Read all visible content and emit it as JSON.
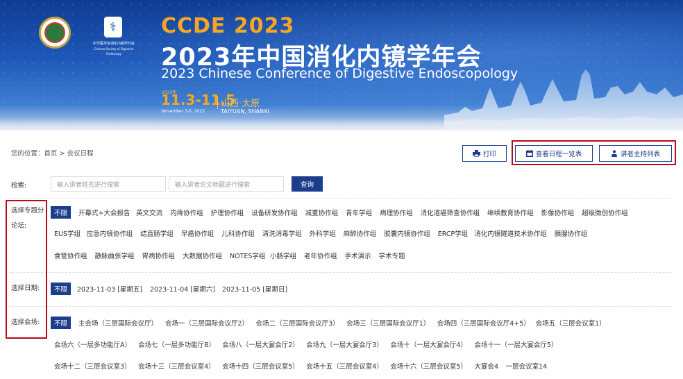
{
  "banner": {
    "ccde": "CCDE 2023",
    "title_cn": "2023年中国消化内镜学年会",
    "title_en": "2023 Chinese Conference of Digestive Endoscopology",
    "date_year": "2023年",
    "date_big": "11.3-11.5",
    "date_small": "November 3-5, 2023",
    "location_cn": "山西·太原",
    "location_en": "TAIYUAN, SHANXI",
    "logo2_text_cn": "中华医学会消化内镜学分会",
    "logo2_text_en": "Chinese Society of Digestive Endoscopy"
  },
  "breadcrumb": {
    "prefix": "您的位置：",
    "home": "首页",
    "sep": ">",
    "current": "会议日程"
  },
  "toolbar": {
    "print": "打印",
    "schedule_overview": "查看日程一览表",
    "speaker_list": "讲者主持列表"
  },
  "search": {
    "label": "检索:",
    "speaker_placeholder": "输入讲者姓名进行搜索",
    "title_placeholder": "输入讲者论文标题进行搜索",
    "button": "查询"
  },
  "filters": {
    "forum": {
      "label_line1": "选择专题分",
      "label_line2": "论坛:",
      "rows": [
        [
          "不限",
          "开幕式+大会报告",
          "英文交流",
          "内痔协作组",
          "护理协作组",
          "设备研发协作组",
          "减重协作组",
          "青年学组",
          "病理协作组",
          "消化道癌筛查协作组",
          "继续教育协作组",
          "影像协作组",
          "超级微创协作组"
        ],
        [
          "EUS学组",
          "应急内镜协作组",
          "结直肠学组",
          "早癌协作组",
          "儿科协作组",
          "清洗消毒学组",
          "外科学组",
          "麻醉协作组",
          "胶囊内镜协作组",
          "ERCP学组",
          "消化内镜隧道技术协作组",
          "胰腺协作组"
        ],
        [
          "食管协作组",
          "静脉曲张学组",
          "胃病协作组",
          "大数据协作组",
          "NOTES学组",
          "小肠学组",
          "老年协作组",
          "手术演示",
          "学术专题"
        ]
      ]
    },
    "date": {
      "label": "选择日期:",
      "items": [
        "不限",
        "2023-11-03 [星期五]",
        "2023-11-04 [星期六]",
        "2023-11-05 [星期日]"
      ]
    },
    "venue": {
      "label": "选择会场:",
      "rows": [
        [
          "不限",
          "主会场（三层国际会议厅）",
          "会场一（三层国际会议厅2）",
          "会场二（三层国际会议厅3）",
          "会场三（三层国际会议厅1）",
          "会场四（三层国际会议厅4+5）",
          "会场五（三层会议室1）"
        ],
        [
          "会场六（一层多功能厅A）",
          "会场七（一层多功能厅B）",
          "会场八（一层大宴会厅2）",
          "会场九（一层大宴会厅3）",
          "会场十（一层大宴会厅4）",
          "会场十一（一层大宴会厅5）"
        ],
        [
          "会场十二（三层会议室3）",
          "会场十三（三层会议室4）",
          "会场十四（三层会议室5）",
          "会场十五（三层会议室4）",
          "会场十六（三层会议室5）",
          "大宴会4",
          "一层会议室14"
        ]
      ]
    }
  },
  "colors": {
    "primary": "#1c3c8c",
    "highlight_border": "#b40d1c",
    "banner_accent": "#f6a623"
  }
}
